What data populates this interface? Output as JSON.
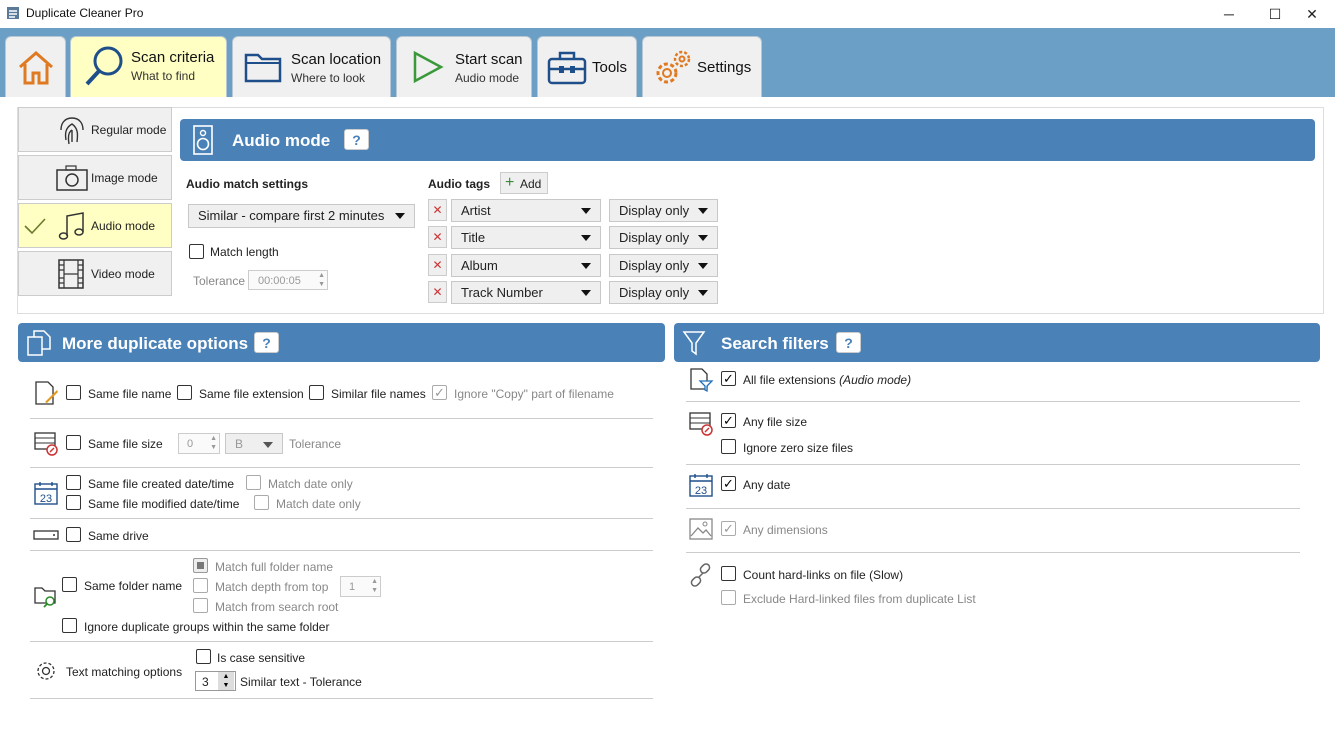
{
  "window": {
    "title": "Duplicate Cleaner Pro",
    "minimize": "─",
    "maximize": "☐",
    "close": "✕"
  },
  "tabs": [
    {
      "label": "",
      "sub": ""
    },
    {
      "label": "Scan criteria",
      "sub": "What to find"
    },
    {
      "label": "Scan location",
      "sub": "Where to look"
    },
    {
      "label": "Start scan",
      "sub": "Audio mode"
    },
    {
      "label": "Tools",
      "sub": ""
    },
    {
      "label": "Settings",
      "sub": ""
    }
  ],
  "modes": [
    "Regular mode",
    "Image mode",
    "Audio mode",
    "Video mode"
  ],
  "audio": {
    "header": "Audio mode",
    "help": "?",
    "match_settings_label": "Audio match settings",
    "match_dropdown": "Similar - compare first 2 minutes",
    "match_length": "Match length",
    "tolerance_label": "Tolerance",
    "tolerance_value": "00:00:05",
    "tags_label": "Audio tags",
    "add_label": "Add",
    "tags": [
      {
        "tag": "Artist",
        "display": "Display only"
      },
      {
        "tag": "Title",
        "display": "Display only"
      },
      {
        "tag": "Album",
        "display": "Display only"
      },
      {
        "tag": "Track Number",
        "display": "Display only"
      }
    ]
  },
  "more": {
    "header": "More duplicate options",
    "help": "?",
    "same_file_name": "Same file name",
    "same_file_extension": "Same file extension",
    "similar_file_names": "Similar file names",
    "ignore_copy": "Ignore \"Copy\" part of filename",
    "same_file_size": "Same file size",
    "size_value": "0",
    "size_unit": "B",
    "tolerance": "Tolerance",
    "created": "Same file created date/time",
    "match_date_only_1": "Match date only",
    "modified": "Same file modified date/time",
    "match_date_only_2": "Match date only",
    "same_drive": "Same drive",
    "same_folder_name": "Same folder name",
    "match_full_folder": "Match full folder name",
    "match_depth": "Match depth from top",
    "depth_value": "1",
    "match_search_root": "Match from search root",
    "ignore_groups": "Ignore duplicate groups within the same folder",
    "text_matching": "Text matching options",
    "case_sensitive": "Is case sensitive",
    "similar_value": "3",
    "similar_text": "Similar text - Tolerance"
  },
  "filters": {
    "header": "Search filters",
    "help": "?",
    "all_ext": "All file extensions",
    "all_ext_note": "(Audio mode)",
    "any_size": "Any file size",
    "ignore_zero": "Ignore zero size files",
    "any_date": "Any date",
    "any_dimensions": "Any dimensions",
    "hardlinks": "Count hard-links on file (Slow)",
    "exclude_hardlinks": "Exclude Hard-linked files from duplicate List"
  },
  "colors": {
    "ribbon": "#6b9fc6",
    "header": "#4a82b8",
    "active_tab": "#ffffc4"
  }
}
